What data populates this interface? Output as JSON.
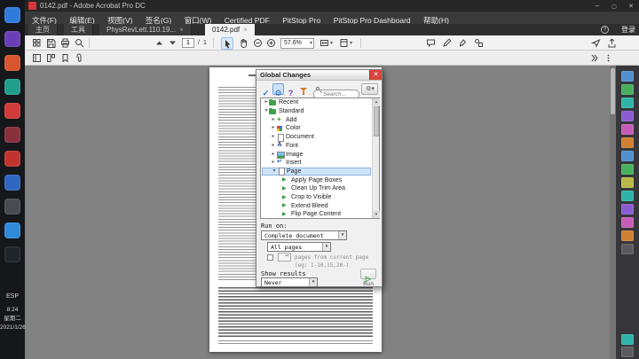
{
  "taskbar": {
    "apps": [
      {
        "name": "app-1",
        "color": "#2f7bd9"
      },
      {
        "name": "app-2",
        "color": "#6a3fb5"
      },
      {
        "name": "app-3",
        "color": "#d8552f"
      },
      {
        "name": "app-4",
        "color": "#1f9e8e"
      },
      {
        "name": "app-5",
        "color": "#d03a3a"
      },
      {
        "name": "app-6",
        "color": "#8a2f3c"
      },
      {
        "name": "app-7",
        "color": "#c0332f"
      },
      {
        "name": "app-8",
        "color": "#2f66c0"
      },
      {
        "name": "app-9",
        "color": "#4a4a52"
      },
      {
        "name": "app-10",
        "color": "#2f8ad9"
      },
      {
        "name": "app-11",
        "color": "#20242b"
      }
    ],
    "language_indicator": "ESP",
    "clock": {
      "time": "8:24",
      "weekday": "星期二",
      "date": "2021/1/26"
    }
  },
  "titlebar": {
    "title": "0142.pdf - Adobe Acrobat Pro DC"
  },
  "menubar": {
    "items": [
      "文件(F)",
      "编辑(E)",
      "视图(V)",
      "签名(G)",
      "窗口(W)",
      "Certified PDF",
      "PitStop Pro",
      "PitStop Pro Dashboard",
      "帮助(H)"
    ]
  },
  "tabbar": {
    "tabs": [
      "主页",
      "工具",
      "PhysRevLett.110.19...",
      "0142.pdf"
    ],
    "signin": "登录"
  },
  "toolbar": {
    "page_current": "1",
    "page_separator": "/",
    "page_total": "1",
    "zoom": "57.6%"
  },
  "dialog": {
    "title": "Global Changes",
    "search_placeholder": "Search...",
    "tree": [
      {
        "label": "Recent"
      },
      {
        "label": "Standard"
      },
      {
        "label": "Add"
      },
      {
        "label": "Color"
      },
      {
        "label": "Document"
      },
      {
        "label": "Font"
      },
      {
        "label": "Image"
      },
      {
        "label": "Insert"
      },
      {
        "label": "Page"
      },
      {
        "label": "Apply Page Boxes"
      },
      {
        "label": "Clean Up Trim Area"
      },
      {
        "label": "Crop to Visible"
      },
      {
        "label": "Extend Bleed"
      },
      {
        "label": "Flip Page Content"
      }
    ],
    "run_on_label": "Run on:",
    "scope_select": "Complete document",
    "pages_select": "All pages",
    "pages_from_label": "pages from current page",
    "pages_hint": "(eg: 1-10,15,20-)",
    "show_results_label": "Show results",
    "results_select": "Never",
    "run_label": "Run"
  },
  "pitstop_strip": {
    "icons": [
      {
        "name": "tool-1",
        "color": "#4f8fd0"
      },
      {
        "name": "tool-2",
        "color": "#46b05c"
      },
      {
        "name": "tool-3",
        "color": "#2fb3a8"
      },
      {
        "name": "tool-4",
        "color": "#8a5bd0"
      },
      {
        "name": "tool-5",
        "color": "#c75bb8"
      },
      {
        "name": "tool-6",
        "color": "#d08030"
      },
      {
        "name": "tool-7",
        "color": "#4f8fd0"
      },
      {
        "name": "tool-8",
        "color": "#46b05c"
      },
      {
        "name": "tool-9",
        "color": "#b8b84a"
      },
      {
        "name": "tool-10",
        "color": "#2fb3a8"
      },
      {
        "name": "tool-11",
        "color": "#8a5bd0"
      },
      {
        "name": "tool-12",
        "color": "#c75bb8"
      },
      {
        "name": "tool-13",
        "color": "#d08030"
      },
      {
        "name": "tool-14",
        "color": "#5a5a60"
      },
      {
        "name": "tool-bottom-1",
        "color": "#2fb3a8"
      },
      {
        "name": "tool-bottom-2",
        "color": "#5a5a60"
      }
    ]
  }
}
